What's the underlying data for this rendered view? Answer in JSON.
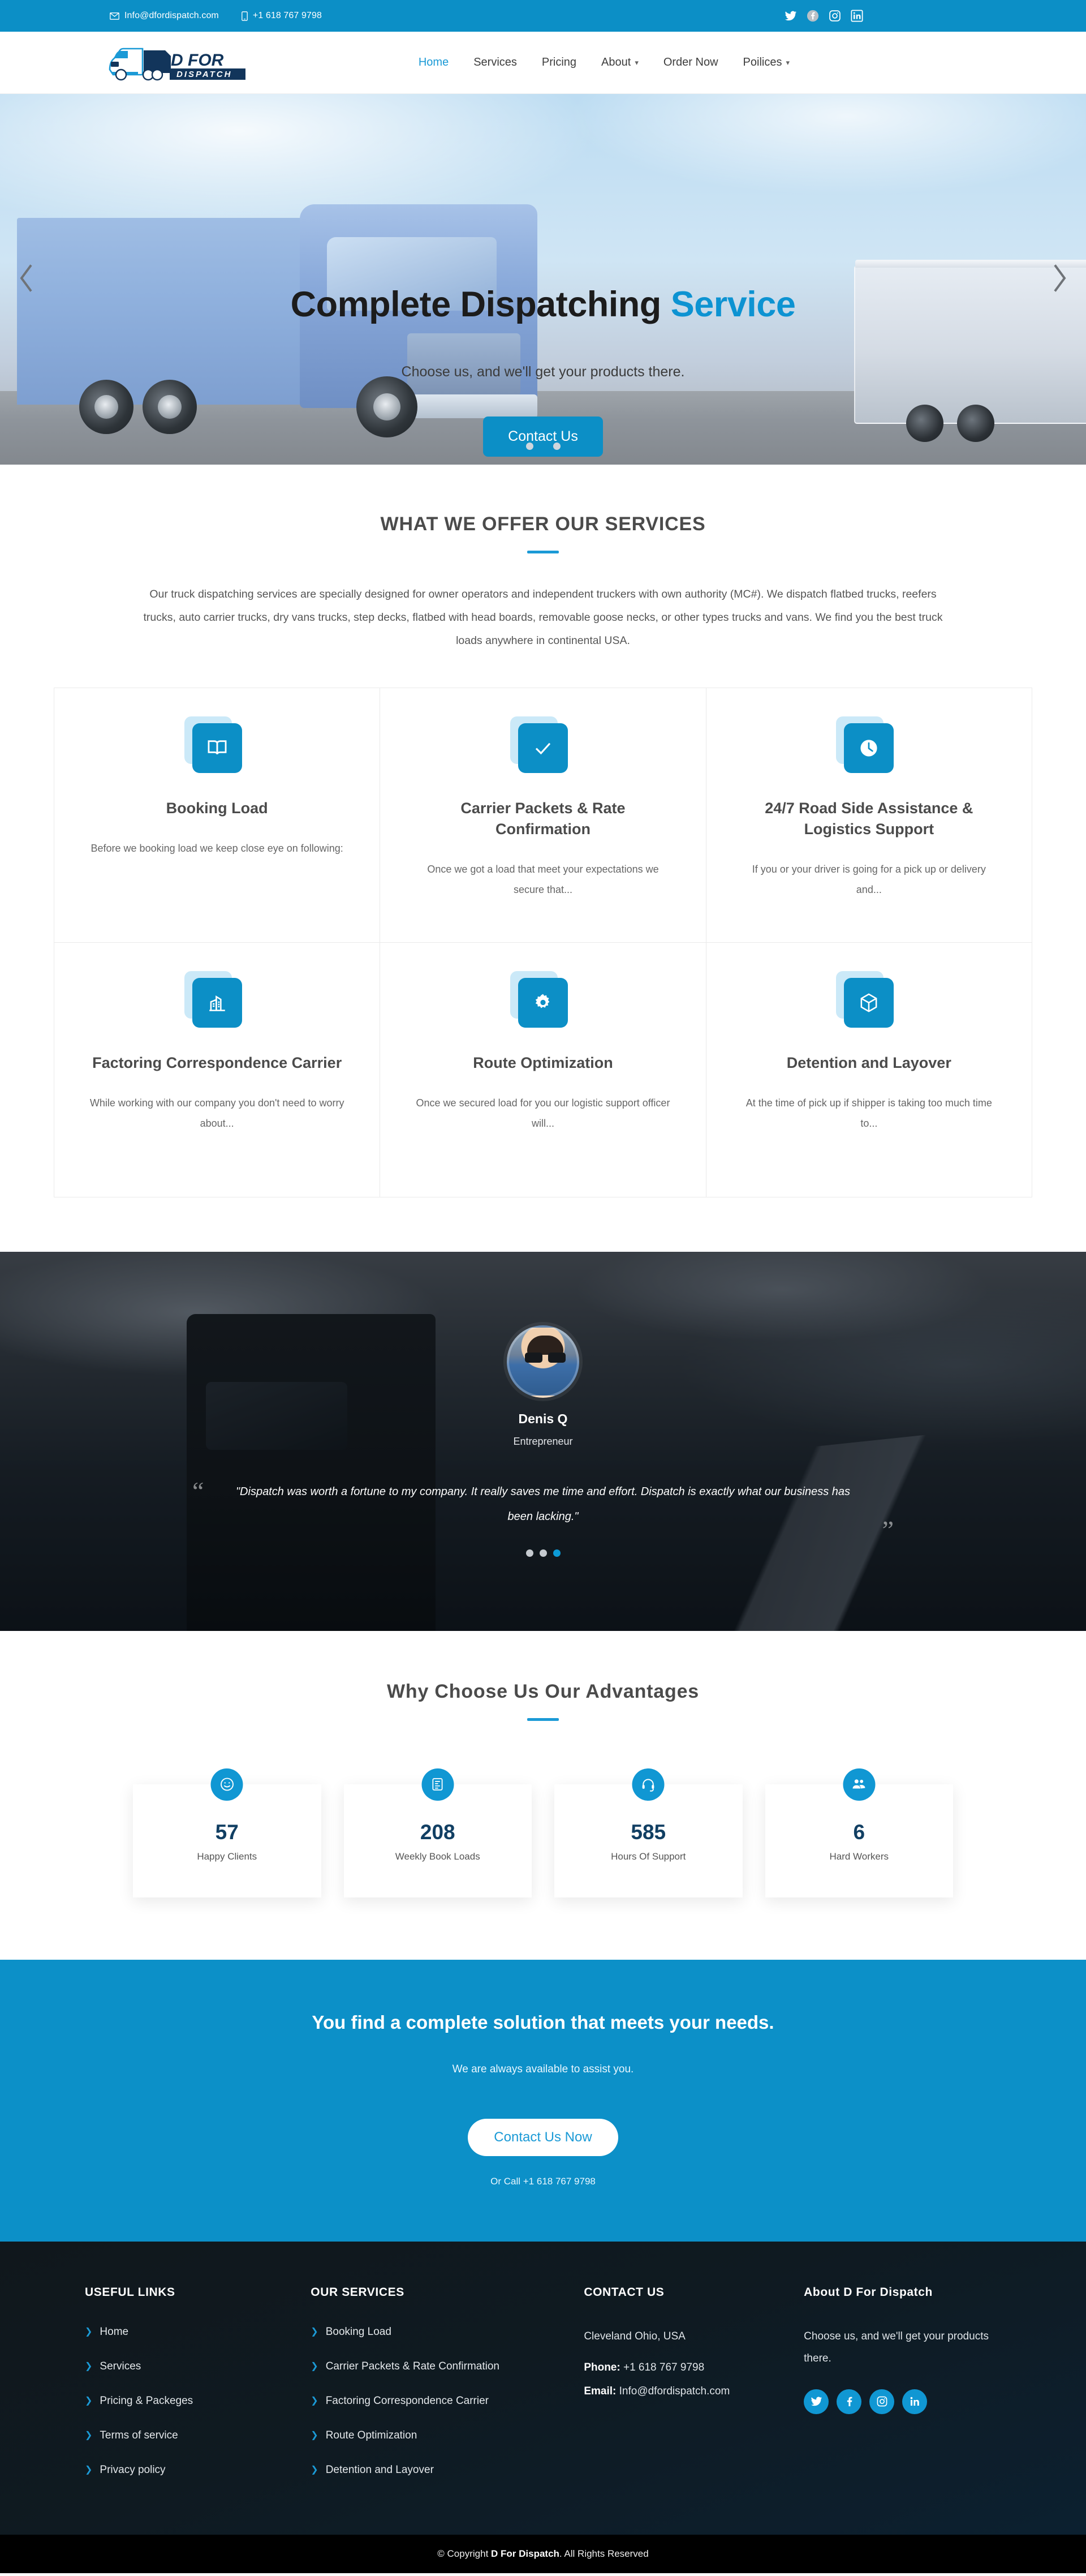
{
  "topbar": {
    "email": "Info@dfordispatch.com",
    "phone": "+1 618 767 9798",
    "socials": [
      "twitter",
      "facebook",
      "instagram",
      "linkedin"
    ]
  },
  "header": {
    "logo_primary": "D FOR",
    "logo_secondary": "DISPATCH",
    "nav": [
      {
        "label": "Home",
        "active": true,
        "caret": ""
      },
      {
        "label": "Services",
        "active": false,
        "caret": ""
      },
      {
        "label": "Pricing",
        "active": false,
        "caret": ""
      },
      {
        "label": "About",
        "active": false,
        "caret": "⌄"
      },
      {
        "label": "Order Now",
        "active": false,
        "caret": ""
      },
      {
        "label": "Poilices",
        "active": false,
        "caret": "⌄"
      }
    ]
  },
  "hero": {
    "title_main": "Complete Dispatching ",
    "title_accent": "Service",
    "subtitle": "Choose us, and we'll get your products there.",
    "button": "Contact Us",
    "prev_icon": "chevron-left-icon",
    "next_icon": "chevron-right-icon",
    "dots": [
      false,
      true,
      false
    ],
    "active_dot": 1
  },
  "services": {
    "title": "WHAT WE OFFER OUR SERVICES",
    "lead": "Our truck dispatching services are specially designed for owner operators and independent truckers with own authority (MC#). We dispatch flatbed trucks, reefers trucks, auto carrier trucks, dry vans trucks, step decks, flatbed with head boards, removable goose necks, or other types trucks and vans. We find you the best truck loads anywhere in continental USA.",
    "cards": [
      {
        "icon": "book-icon",
        "title": "Booking Load",
        "text": "Before we booking load we keep close eye on following:"
      },
      {
        "icon": "check-icon",
        "title": "Carrier Packets & Rate Confirmation",
        "text": "Once we got a load that meet your expectations we secure that..."
      },
      {
        "icon": "clock-icon",
        "title": "24/7 Road Side Assistance & Logistics Support",
        "text": "If you or your driver is going for a pick up or delivery and..."
      },
      {
        "icon": "building-chart-icon",
        "title": "Factoring Correspondence Carrier",
        "text": "While working with our company you don't need to worry about..."
      },
      {
        "icon": "gear-icon",
        "title": "Route Optimization",
        "text": "Once we secured load for you our logistic support officer will..."
      },
      {
        "icon": "cube-icon",
        "title": "Detention and Layover",
        "text": "At the time of pick up if shipper is taking too much time to..."
      }
    ]
  },
  "testimonial": {
    "name": "Denis Q",
    "role": "Entrepreneur",
    "quote": "\"Dispatch was worth a fortune to my company. It really saves me time and effort. Dispatch is exactly what our business has been lacking.\"",
    "quote_open": "“",
    "quote_close": "”",
    "dots": [
      false,
      false,
      true
    ],
    "active_dot": 2
  },
  "why": {
    "title": "Why Choose Us Our Advantages",
    "stats": [
      {
        "icon": "smiley-icon",
        "number": "57",
        "label": "Happy Clients"
      },
      {
        "icon": "clipboard-icon",
        "number": "208",
        "label": "Weekly Book Loads"
      },
      {
        "icon": "headset-icon",
        "number": "585",
        "label": "Hours Of Support"
      },
      {
        "icon": "people-icon",
        "number": "6",
        "label": "Hard Workers"
      }
    ]
  },
  "cta": {
    "title": "You find a complete solution that meets your needs.",
    "subtitle": "We are always available to assist you.",
    "button": "Contact Us Now",
    "call": "Or Call +1 618 767 9798"
  },
  "footer": {
    "col1": {
      "heading": "USEFUL LINKS",
      "links": [
        "Home",
        "Services",
        "Pricing & Packeges",
        "Terms of service",
        "Privacy policy"
      ]
    },
    "col2": {
      "heading": "OUR SERVICES",
      "links": [
        "Booking Load",
        "Carrier Packets & Rate Confirmation",
        "Factoring Correspondence Carrier",
        "Route Optimization",
        "Detention and Layover"
      ]
    },
    "col3": {
      "heading": "CONTACT US",
      "address": "Cleveland Ohio, USA",
      "phone_label": "Phone:",
      "phone": "+1 618 767 9798",
      "email_label": "Email:",
      "email": "Info@dfordispatch.com"
    },
    "col4": {
      "heading": "About D For Dispatch",
      "text": "Choose us, and we'll get your products there.",
      "socials": [
        "twitter",
        "facebook",
        "instagram",
        "linkedin"
      ]
    },
    "copyright_pre": "© Copyright ",
    "copyright_brand": "D For Dispatch",
    "copyright_post": ". All Rights Reserved"
  },
  "colors": {
    "brand_blue": "#0c8fc6",
    "accent_blue": "#1b9ad6",
    "footer_dark": "#10171c",
    "stat_number": "#113f63"
  }
}
